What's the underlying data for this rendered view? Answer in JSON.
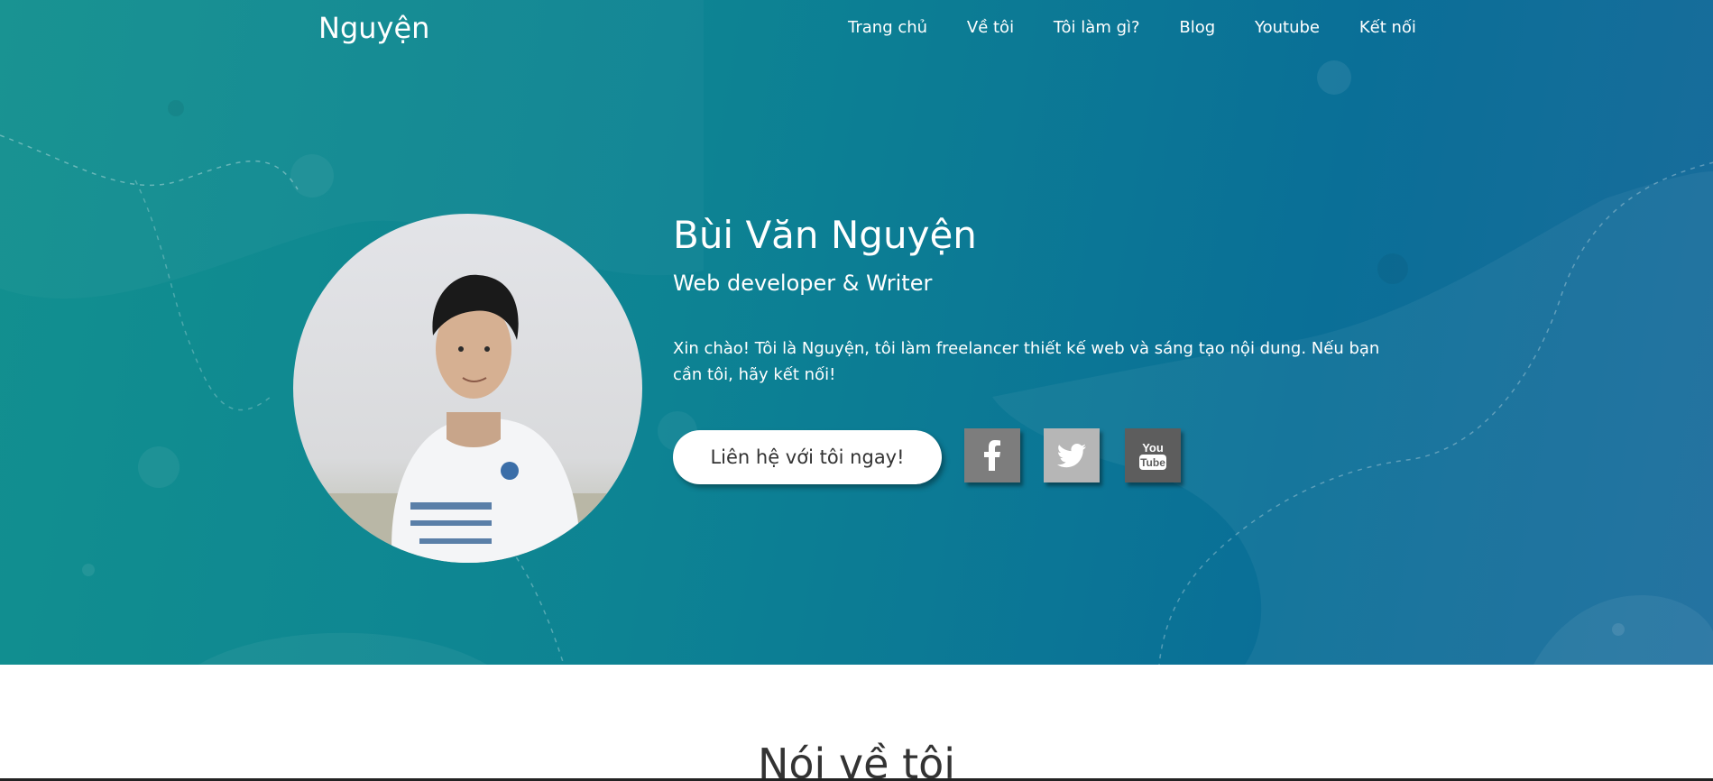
{
  "header": {
    "logo": "Nguyện",
    "nav": [
      "Trang chủ",
      "Về tôi",
      "Tôi làm gì?",
      "Blog",
      "Youtube",
      "Kết nối"
    ]
  },
  "hero": {
    "name": "Bùi Văn Nguyện",
    "role": "Web developer & Writer",
    "intro": "Xin chào! Tôi là Nguyện, tôi làm freelancer thiết kế web và sáng tạo nội dung. Nếu bạn cần tôi, hãy kết nối!",
    "cta_label": "Liên hệ với tôi ngay!",
    "social": [
      {
        "name": "facebook",
        "icon": "facebook-icon"
      },
      {
        "name": "twitter",
        "icon": "twitter-icon"
      },
      {
        "name": "youtube",
        "icon": "youtube-icon",
        "text": "You Tube"
      }
    ],
    "colors": {
      "gradient_start": "#12908f",
      "gradient_end": "#1a6c9c"
    }
  },
  "about": {
    "title": "Nói về tôi"
  }
}
